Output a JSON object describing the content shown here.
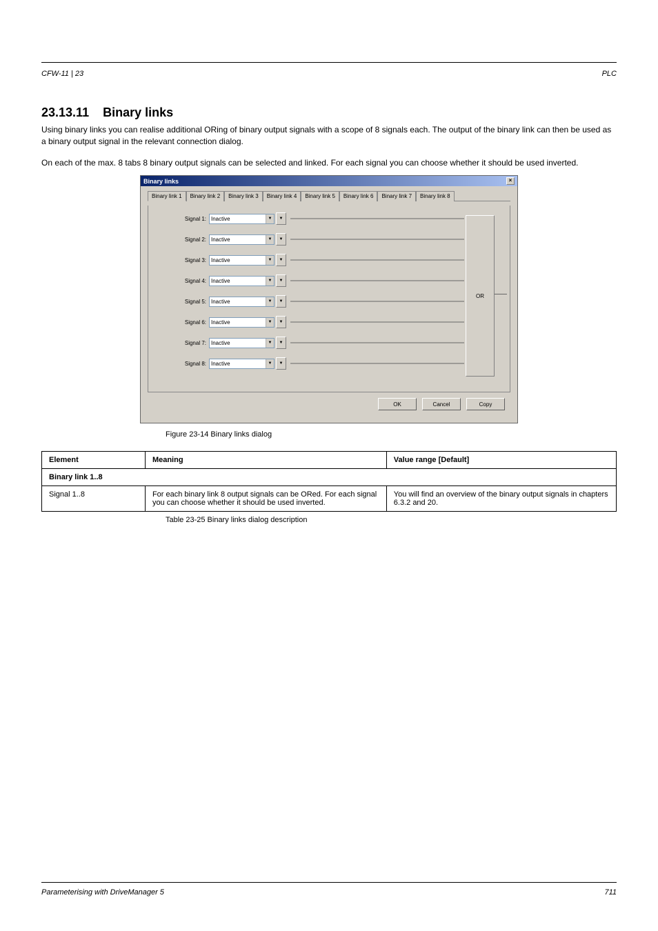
{
  "header": {
    "left": "CFW-11 | 23",
    "right": "PLC"
  },
  "section": {
    "num": "23.13.11",
    "title": "Binary links",
    "desc": "Using binary links you can realise additional ORing of binary output signals with a scope of 8 signals each. The output of the binary link can then be used as a binary output signal in the relevant connection dialog.",
    "desc2": "On each of the max. 8 tabs 8 binary output signals can be selected and linked. For each signal you can choose whether it should be used inverted."
  },
  "dialog": {
    "title": "Binary links",
    "tabs": [
      "Binary link 1",
      "Binary link 2",
      "Binary link 3",
      "Binary link 4",
      "Binary link 5",
      "Binary link 6",
      "Binary link 7",
      "Binary link 8"
    ],
    "signals": [
      {
        "label": "Signal 1:",
        "value": "Inactive"
      },
      {
        "label": "Signal 2:",
        "value": "Inactive"
      },
      {
        "label": "Signal 3:",
        "value": "Inactive"
      },
      {
        "label": "Signal 4:",
        "value": "Inactive"
      },
      {
        "label": "Signal 5:",
        "value": "Inactive"
      },
      {
        "label": "Signal 6:",
        "value": "Inactive"
      },
      {
        "label": "Signal 7:",
        "value": "Inactive"
      },
      {
        "label": "Signal 8:",
        "value": "Inactive"
      }
    ],
    "or": "OR",
    "buttons": {
      "ok": "OK",
      "cancel": "Cancel",
      "copy": "Copy"
    }
  },
  "figure_caption": "Figure 23-14 Binary links dialog",
  "table": {
    "headers": [
      "Element",
      "Meaning",
      "Value range [Default]"
    ],
    "group": "Binary link 1..8",
    "row": {
      "el": "Signal 1..8",
      "meaning": "For each binary link 8 output signals can be ORed. For each signal you can choose whether it should be used inverted.",
      "range": "You will find an overview of the binary output signals in chapters 6.3.2 and 20."
    }
  },
  "table_caption": "Table 23-25 Binary links dialog description",
  "footer": {
    "left": "Parameterising with DriveManager 5",
    "right": "711"
  }
}
